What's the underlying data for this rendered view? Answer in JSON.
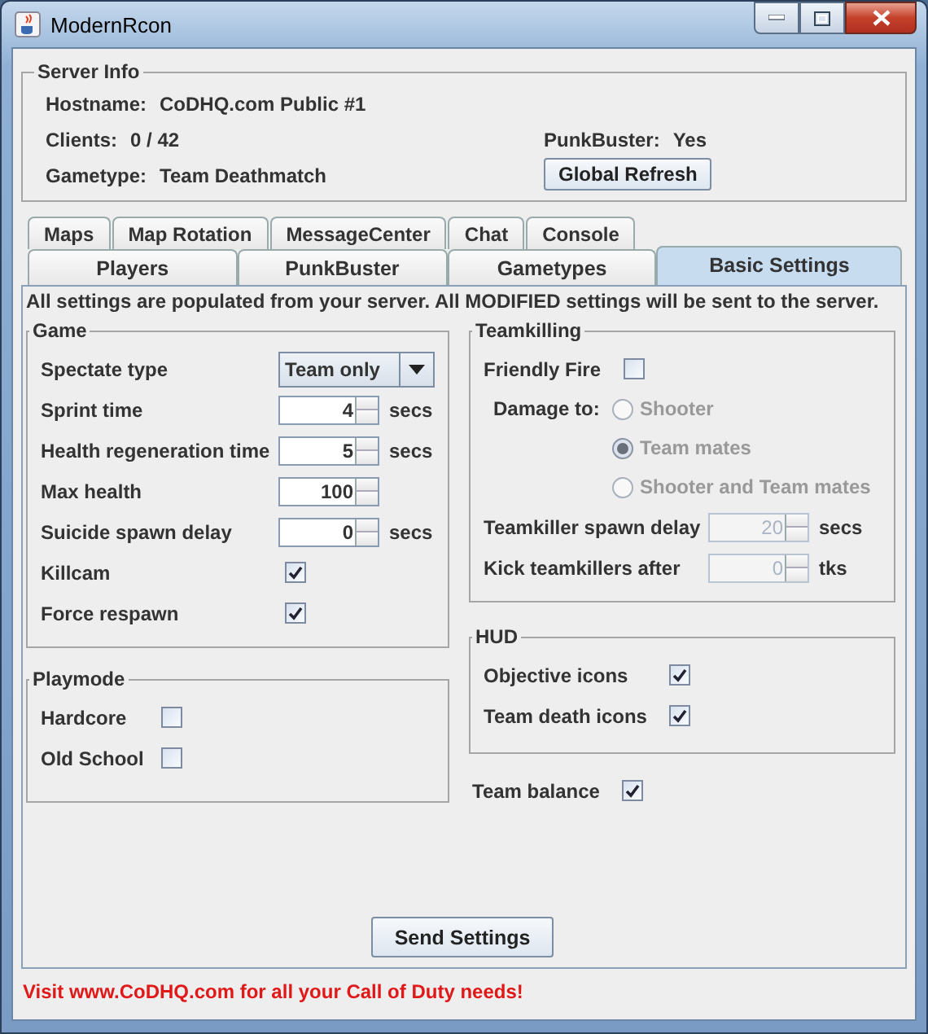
{
  "window": {
    "title": "ModernRcon"
  },
  "server_info": {
    "title": "Server Info",
    "fields": [
      {
        "label": "Hostname:",
        "value": "CoDHQ.com Public #1"
      },
      {
        "label": "Clients:",
        "value": "0 / 42"
      },
      {
        "label": "Gametype:",
        "value": "Team Deathmatch"
      },
      {
        "label": "PunkBuster:",
        "value": "Yes"
      }
    ],
    "refresh_button": "Global Refresh"
  },
  "tabs": [
    [
      {
        "label": "Maps",
        "selected": false
      },
      {
        "label": "Map Rotation",
        "selected": false
      },
      {
        "label": "MessageCenter",
        "selected": false
      },
      {
        "label": "Chat",
        "selected": false
      },
      {
        "label": "Console",
        "selected": false
      }
    ],
    [
      {
        "label": "Players",
        "selected": false
      },
      {
        "label": "PunkBuster",
        "selected": false
      },
      {
        "label": "Gametypes",
        "selected": false
      },
      {
        "label": "Basic Settings",
        "selected": true
      }
    ]
  ],
  "notice": "All settings are populated from your server. All MODIFIED settings will be sent to the server.",
  "groups_left": [
    {
      "title": "Game",
      "items": [
        {
          "kind": "dropdown",
          "label": "Spectate type",
          "value": "Team only"
        },
        {
          "kind": "spinner",
          "label": "Sprint time",
          "value": "4",
          "unit": "secs"
        },
        {
          "kind": "spinner",
          "label": "Health regeneration time",
          "value": "5",
          "unit": "secs"
        },
        {
          "kind": "spinner",
          "label": "Max health",
          "value": "100"
        },
        {
          "kind": "spinner",
          "label": "Suicide spawn delay",
          "value": "0",
          "unit": "secs"
        },
        {
          "kind": "checkbox",
          "label": "Killcam",
          "checked": true
        },
        {
          "kind": "checkbox",
          "label": "Force respawn",
          "checked": true
        }
      ]
    },
    {
      "title": "Playmode",
      "items": [
        {
          "kind": "checkbox",
          "label": "Hardcore",
          "checked": false
        },
        {
          "kind": "checkbox",
          "label": "Old School",
          "checked": false
        }
      ]
    }
  ],
  "groups_right": [
    {
      "title": "Teamkilling",
      "items": [
        {
          "kind": "checkbox",
          "label": "Friendly Fire",
          "checked": false,
          "disabled": false
        },
        {
          "kind": "radio_group",
          "label": "Damage to:",
          "disabled": true,
          "options": [
            {
              "label": "Shooter",
              "selected": false
            },
            {
              "label": "Team mates",
              "selected": true
            },
            {
              "label": "Shooter and Team mates",
              "selected": false
            }
          ]
        },
        {
          "kind": "spinner",
          "label": "Teamkiller spawn delay",
          "value": "20",
          "unit": "secs",
          "disabled": true
        },
        {
          "kind": "spinner",
          "label": "Kick teamkillers after",
          "value": "0",
          "unit": "tks",
          "disabled": true
        }
      ]
    },
    {
      "title": "HUD",
      "items": [
        {
          "kind": "checkbox",
          "label": "Objective icons",
          "checked": true
        },
        {
          "kind": "checkbox",
          "label": "Team death icons",
          "checked": true
        }
      ]
    }
  ],
  "team_balance": {
    "label": "Team balance",
    "checked": true
  },
  "send_button": "Send Settings",
  "footer": "Visit www.CoDHQ.com for all your Call of Duty needs!"
}
